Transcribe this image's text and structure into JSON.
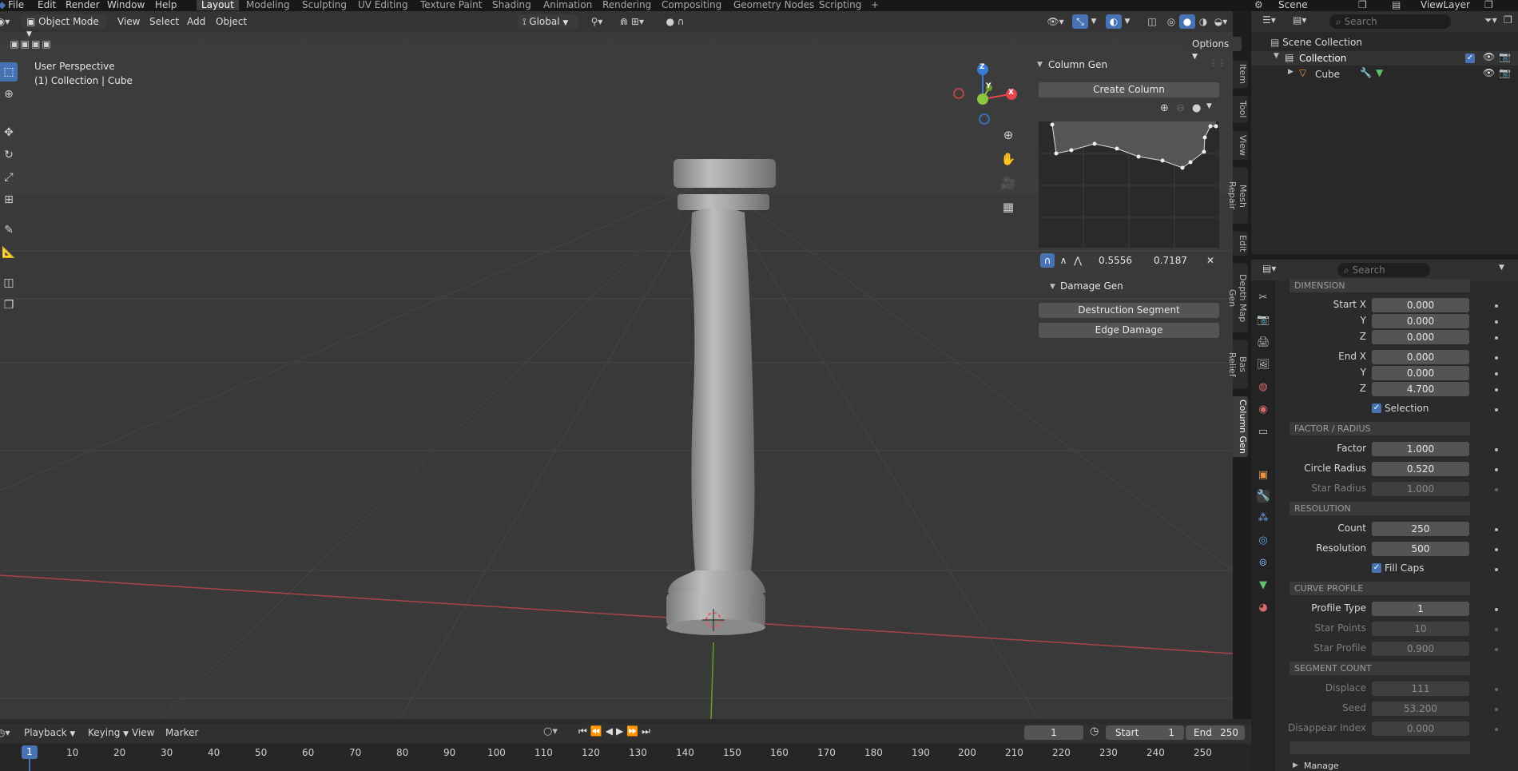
{
  "menu": {
    "items": [
      "File",
      "Edit",
      "Render",
      "Window",
      "Help"
    ],
    "workspaces": [
      "Layout",
      "Modeling",
      "Sculpting",
      "UV Editing",
      "Texture Paint",
      "Shading",
      "Animation",
      "Rendering",
      "Compositing",
      "Geometry Nodes",
      "Scripting"
    ],
    "active_workspace": "Layout",
    "add_tab": "+",
    "scene": "Scene",
    "view_layer": "ViewLayer"
  },
  "viewport_header": {
    "mode": "Object Mode",
    "menus": [
      "View",
      "Select",
      "Add",
      "Object"
    ],
    "orientation": "Global",
    "options": "Options"
  },
  "viewport": {
    "perspective": "User Perspective",
    "context": "(1) Collection | Cube"
  },
  "gizmo": {
    "z": "Z",
    "y": "Y",
    "x": "X"
  },
  "npanel": {
    "column_gen_title": "Column Gen",
    "create_column": "Create Column",
    "curve_x": "0.5556",
    "curve_y": "0.7187",
    "damage_gen_title": "Damage Gen",
    "destruction_segment": "Destruction Segment",
    "edge_damage": "Edge Damage"
  },
  "side_tabs": [
    "Item",
    "Tool",
    "View",
    "Mesh Repair",
    "Edit",
    "Depth Map Gen",
    "Bas Relief",
    "Column Gen"
  ],
  "outliner": {
    "search_placeholder": "Search",
    "scene_collection": "Scene Collection",
    "collection": "Collection",
    "cube": "Cube"
  },
  "properties": {
    "search_placeholder": "Search",
    "dimension": "Dimension",
    "start_x_label": "Start X",
    "start_x": "0.000",
    "start_y_label": "Y",
    "start_y": "0.000",
    "start_z_label": "Z",
    "start_z": "0.000",
    "end_x_label": "End X",
    "end_x": "0.000",
    "end_y_label": "Y",
    "end_y": "0.000",
    "end_z_label": "Z",
    "end_z": "4.700",
    "selection_label": "Selection",
    "factor_radius": "Factor / Radius",
    "factor_label": "Factor",
    "factor": "1.000",
    "circle_radius_label": "Circle Radius",
    "circle_radius": "0.520",
    "star_radius_label": "Star Radius",
    "star_radius": "1.000",
    "resolution_section": "Resolution",
    "count_label": "Count",
    "count": "250",
    "resolution_label": "Resolution",
    "resolution": "500",
    "fill_caps_label": "Fill Caps",
    "curve_profile": "Curve Profile",
    "profile_type_label": "Profile Type",
    "profile_type": "1",
    "star_points_label": "Star Points",
    "star_points": "10",
    "star_profile_label": "Star Profile",
    "star_profile": "0.900",
    "segment_count": "Segment Count",
    "displace_label": "Displace",
    "displace": "111",
    "seed_label": "Seed",
    "seed": "53.200",
    "disappear_index_label": "Disappear Index",
    "disappear_index": "0.000",
    "manage": "Manage"
  },
  "timeline": {
    "menus": [
      "Playback",
      "Keying",
      "View",
      "Marker"
    ],
    "current_frame": "1",
    "start_label": "Start",
    "start": "1",
    "end_label": "End",
    "end": "250",
    "ruler": [
      "1",
      "10",
      "20",
      "30",
      "40",
      "50",
      "60",
      "70",
      "80",
      "90",
      "100",
      "110",
      "120",
      "130",
      "140",
      "150",
      "160",
      "170",
      "180",
      "190",
      "200",
      "210",
      "220",
      "230",
      "240",
      "250"
    ]
  },
  "colors": {
    "accent": "#4772b3",
    "x_axis": "#e0464b",
    "y_axis": "#8cc63f",
    "z_axis": "#3a7bd5"
  }
}
